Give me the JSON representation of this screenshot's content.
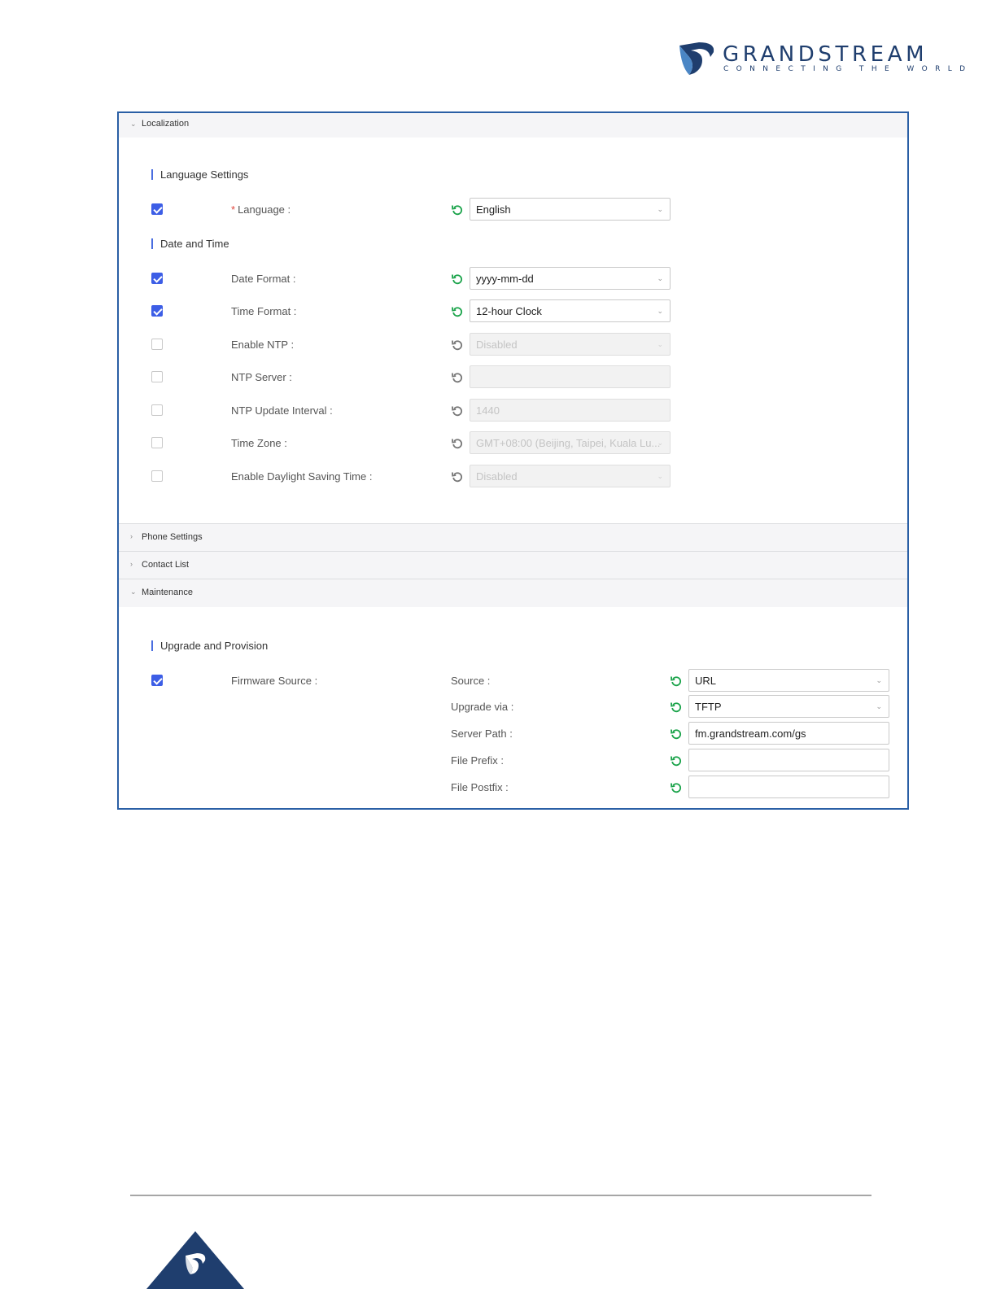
{
  "logo": {
    "wordmark": "GRANDSTREAM",
    "tagline": "CONNECTING THE WORLD",
    "colors": {
      "primary": "#1f3e6e",
      "accent": "#4a86c5"
    }
  },
  "sections": {
    "localization": {
      "label": "Localization",
      "chevron": "⌄"
    },
    "phone_settings": {
      "label": "Phone Settings",
      "chevron": "›"
    },
    "contact_list": {
      "label": "Contact List",
      "chevron": "›"
    },
    "maintenance": {
      "label": "Maintenance",
      "chevron": "⌄"
    }
  },
  "language_settings": {
    "title": "Language Settings",
    "language": {
      "required_mark": "*",
      "label": "Language :",
      "value": "English",
      "checked": true
    }
  },
  "date_time": {
    "title": "Date and Time",
    "date_format": {
      "label": "Date Format :",
      "value": "yyyy-mm-dd",
      "checked": true
    },
    "time_format": {
      "label": "Time Format :",
      "value": "12-hour Clock",
      "checked": true
    },
    "enable_ntp": {
      "label": "Enable NTP :",
      "value": "Disabled",
      "checked": false
    },
    "ntp_server": {
      "label": "NTP Server :",
      "value": "",
      "checked": false
    },
    "ntp_update_interval": {
      "label": "NTP Update Interval :",
      "value": "1440",
      "checked": false
    },
    "time_zone": {
      "label": "Time Zone :",
      "value": "GMT+08:00 (Beijing, Taipei, Kuala Lu...",
      "checked": false
    },
    "daylight_saving": {
      "label": "Enable Daylight Saving Time :",
      "value": "Disabled",
      "checked": false
    }
  },
  "upgrade_provision": {
    "title": "Upgrade and Provision",
    "firmware_source": {
      "label": "Firmware Source :",
      "checked": true
    },
    "source": {
      "label": "Source :",
      "value": "URL"
    },
    "upgrade_via": {
      "label": "Upgrade via :",
      "value": "TFTP"
    },
    "server_path": {
      "label": "Server Path :",
      "value": "fm.grandstream.com/gs"
    },
    "file_prefix": {
      "label": "File Prefix :",
      "value": ""
    },
    "file_postfix": {
      "label": "File Postfix :",
      "value": ""
    }
  },
  "icons": {
    "reset": "reset-icon",
    "dropdown": "⌄",
    "checkbox_on_color": "#3d5ee6",
    "reset_active_color": "#1aa34a",
    "reset_disabled_color": "#777777"
  }
}
